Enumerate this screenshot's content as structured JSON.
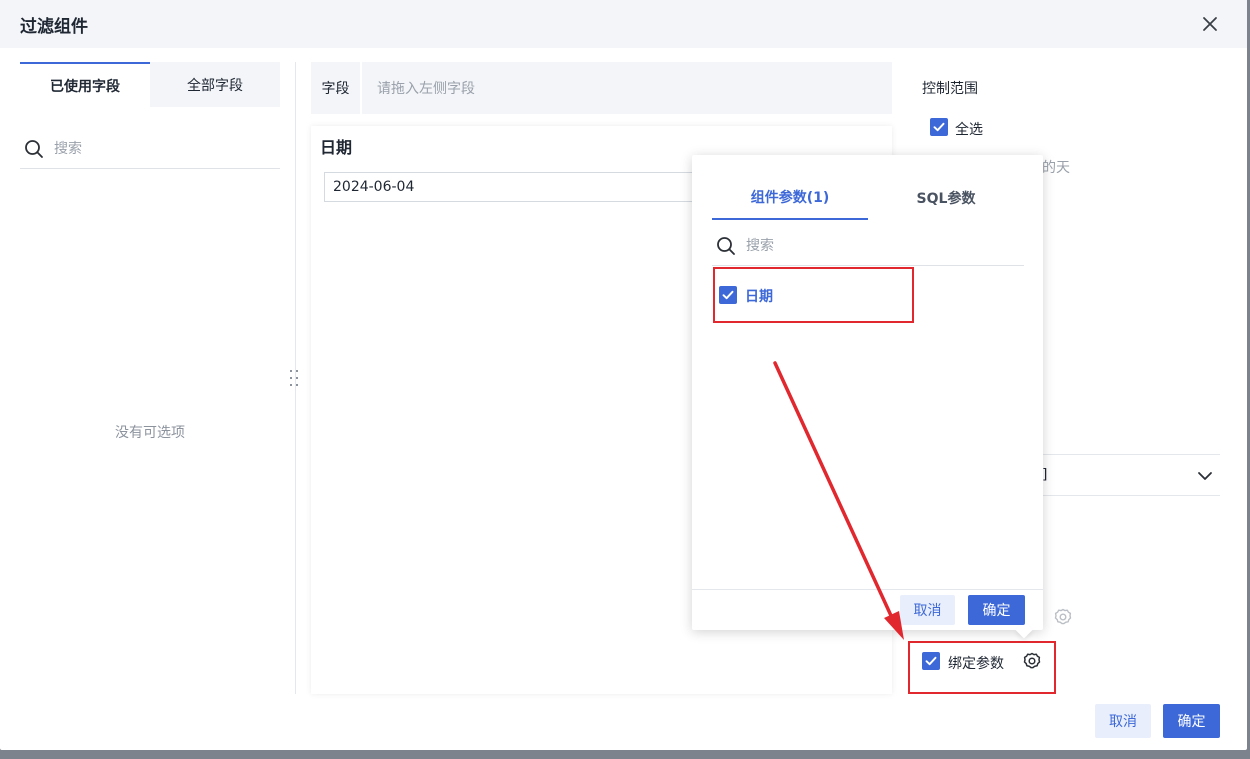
{
  "dialog": {
    "title": "过滤组件"
  },
  "left_panel": {
    "tabs": [
      {
        "label": "已使用字段",
        "active": true
      },
      {
        "label": "全部字段",
        "active": false
      }
    ],
    "search_placeholder": "搜索",
    "empty_text": "没有可选项"
  },
  "middle_panel": {
    "field_label": "字段",
    "field_drop_placeholder": "请拖入左侧字段",
    "preview_title": "日期",
    "date_value": "2024-06-04"
  },
  "right_panel": {
    "control_range_title": "控制范围",
    "select_all_label": "全选",
    "partial_text": "的天",
    "select_partial_value": "]",
    "bind_params_label": "绑定参数"
  },
  "popover": {
    "tabs": [
      {
        "label": "组件参数(1)",
        "active": true
      },
      {
        "label": "SQL参数",
        "active": false
      }
    ],
    "search_placeholder": "搜索",
    "items": [
      {
        "label": "日期",
        "checked": true
      }
    ],
    "cancel_label": "取消",
    "confirm_label": "确定"
  },
  "footer": {
    "cancel_label": "取消",
    "confirm_label": "确定"
  },
  "colors": {
    "primary": "#3d68d8",
    "annotation_red": "#e0282e",
    "header_bg": "#f3f5f8"
  }
}
